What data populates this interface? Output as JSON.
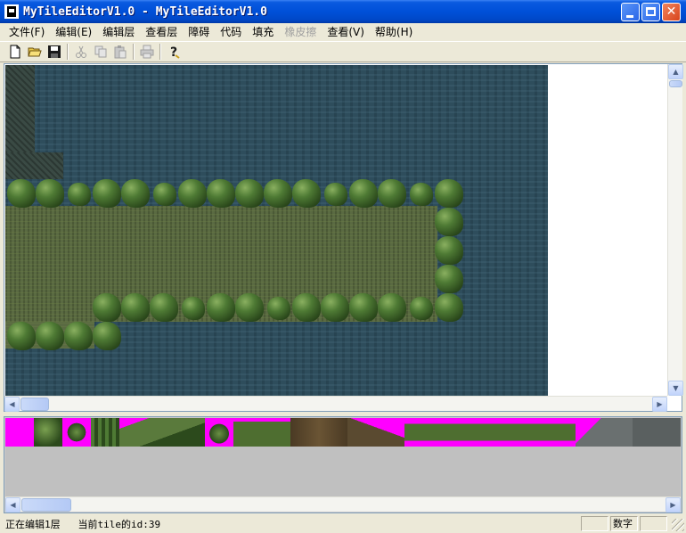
{
  "window": {
    "title": "MyTileEditorV1.0 - MyTileEditorV1.0"
  },
  "menu": {
    "items": [
      {
        "label": "文件(F)",
        "enabled": true
      },
      {
        "label": "编辑(E)",
        "enabled": true
      },
      {
        "label": "编辑层",
        "enabled": true
      },
      {
        "label": "查看层",
        "enabled": true
      },
      {
        "label": "障碍",
        "enabled": true
      },
      {
        "label": "代码",
        "enabled": true
      },
      {
        "label": "填充",
        "enabled": true
      },
      {
        "label": "橡皮擦",
        "enabled": false
      },
      {
        "label": "查看(V)",
        "enabled": true
      },
      {
        "label": "帮助(H)",
        "enabled": true
      }
    ]
  },
  "toolbar": {
    "buttons": [
      {
        "icon": "new-file-icon",
        "enabled": true
      },
      {
        "icon": "open-folder-icon",
        "enabled": true
      },
      {
        "icon": "save-icon",
        "enabled": true
      },
      {
        "icon": "cut-icon",
        "enabled": false
      },
      {
        "icon": "copy-icon",
        "enabled": false
      },
      {
        "icon": "paste-icon",
        "enabled": false
      },
      {
        "icon": "print-icon",
        "enabled": false
      },
      {
        "icon": "help-icon",
        "enabled": true
      }
    ]
  },
  "status": {
    "editing_layer": "正在编辑1层",
    "current_tile": "当前tile的id:39",
    "num_indicator": "数字"
  },
  "colors": {
    "water": "#2e4d5c",
    "grass": "#5a6a42",
    "tileset_transparent": "#ff00ff",
    "titlebar": "#0050d8"
  }
}
